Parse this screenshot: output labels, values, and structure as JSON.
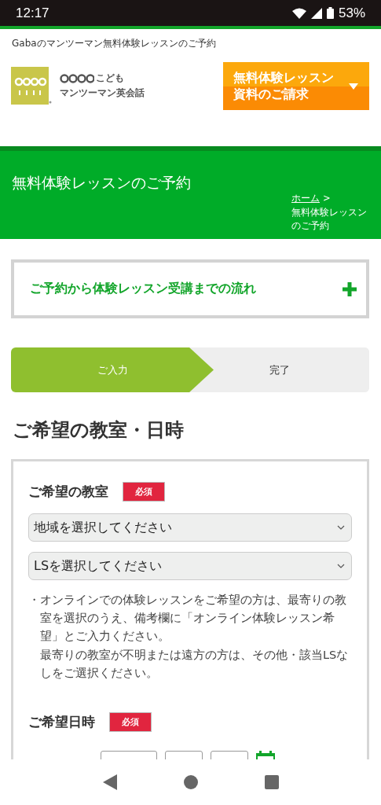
{
  "status_bar": {
    "time": "12:17",
    "battery": "53%"
  },
  "header": {
    "tagline": "Gabaのマンツーマン無料体験レッスンのご予約",
    "logo_text": "マンツーマン英会話",
    "logo_sub": "こども",
    "cta": [
      "無料体験レッスン",
      "資料のご請求"
    ]
  },
  "banner": {
    "title": "無料体験レッスンのご予約",
    "breadcrumb": [
      {
        "label": "ホーム",
        "link": true,
        "separator": ">"
      },
      {
        "label": "無料体験レッスンのご予約",
        "link": false
      }
    ]
  },
  "accordion": {
    "label": "ご予約から体験レッスン受講までの流れ",
    "expanded": false
  },
  "steps": [
    {
      "label": "ご入力",
      "selected": true
    },
    {
      "label": "完了",
      "selected": false
    }
  ],
  "section_title": "ご希望の教室・日時",
  "form": {
    "classroom": {
      "label": "ご希望の教室",
      "badge": "必須",
      "selects": [
        {
          "placeholder": "地域を選択してください"
        },
        {
          "placeholder": "LSを選択してください"
        }
      ],
      "notes": [
        {
          "bullet": "・",
          "lines": [
            "オンラインでの体験レッスンをご希望の方は、最寄りの教室を選択のうえ、備考欄に「オンライン体験レッスン希望」とご入力ください。",
            "最寄りの教室が不明または遠方の方は、その他・該当LSなしをご選択ください。"
          ]
        }
      ]
    },
    "datetime": {
      "label": "ご希望日時",
      "badge": "必須"
    }
  }
}
